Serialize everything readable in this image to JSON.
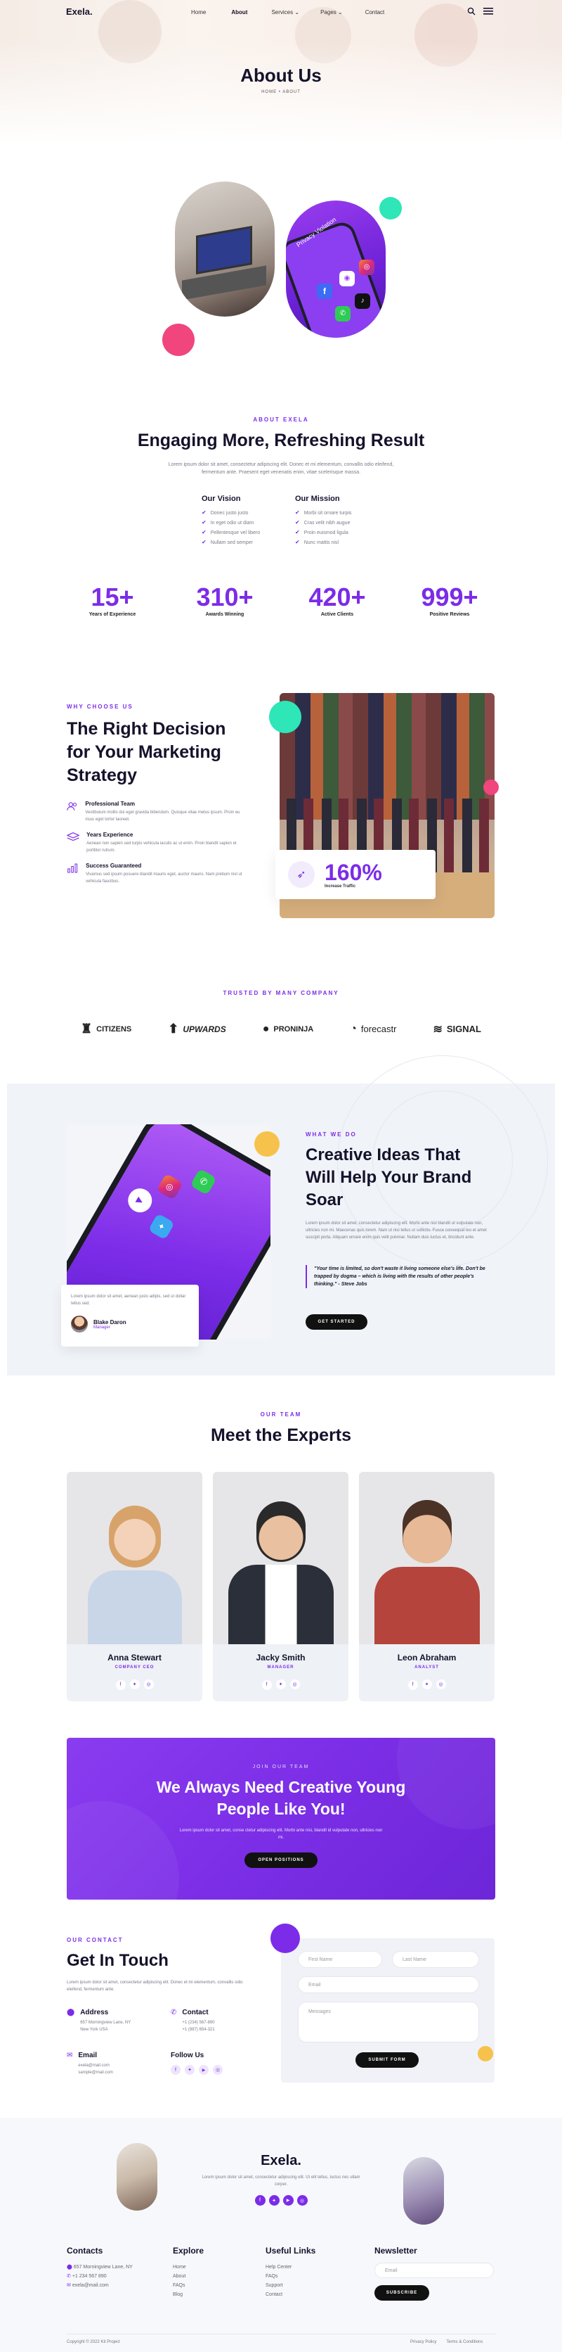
{
  "brand": {
    "logo": "Exela."
  },
  "nav": {
    "items": [
      {
        "label": "Home"
      },
      {
        "label": "About"
      },
      {
        "label": "Services",
        "caret": "⌄"
      },
      {
        "label": "Pages",
        "caret": "⌄"
      },
      {
        "label": "Contact"
      }
    ]
  },
  "hero": {
    "title": "About Us",
    "crumb_home": "HOME",
    "crumb_sep": "•",
    "crumb_current": "ABOUT"
  },
  "about": {
    "eyebrow": "ABOUT EXELA",
    "title": "Engaging More, Refreshing Result",
    "desc": "Lorem ipsum dolor sit amet, consectetur adipiscing elit. Donec et mi elementum, convallis odio eleifend, fermentum ante. Praesent eget venenatis enim, vitae scelerisque massa.",
    "phone_text": "Privacy Violation",
    "vision": {
      "title": "Our Vision",
      "items": [
        "Donec justo justo",
        "In eget odio ut diam",
        "Pellentesque vel libero",
        "Nullam sed semper"
      ]
    },
    "mission": {
      "title": "Our Mission",
      "items": [
        "Morbi sit ornare turpis",
        "Cras velit nibh augue",
        "Proin euismod ligula",
        "Nunc mattis nisl"
      ]
    }
  },
  "stats": [
    {
      "num": "15+",
      "label": "Years of Experience"
    },
    {
      "num": "310+",
      "label": "Awards Winning"
    },
    {
      "num": "420+",
      "label": "Active Clients"
    },
    {
      "num": "999+",
      "label": "Positive Reviews"
    }
  ],
  "why": {
    "eyebrow": "WHY CHOOSE US",
    "title_l1": "The Right Decision",
    "title_l2": "for Your Marketing",
    "title_l3": "Strategy",
    "features": [
      {
        "title": "Professional Team",
        "desc": "Vestibulum mollis dui eget gravida bibendum. Quisque vitae metus ipsum. Proin eu risus eget tortor laoreet."
      },
      {
        "title": "Years Experience",
        "desc": "Aenean non sapien sed turpis vehicula iaculis ac ut enim. Proin blandit sapien et porttitor rutrum."
      },
      {
        "title": "Success Guaranteed",
        "desc": "Vivamus sed ipsum posuere blandit mauris eget, auctor mauris. Nam pretium nisl ut vehicula faucibus."
      }
    ],
    "badge_num": "160%",
    "badge_label": "Increase Traffic"
  },
  "trusted": {
    "eyebrow": "TRUSTED BY MANY COMPANY",
    "logos": [
      "CITIZENS",
      "UPWARDS",
      "PRONINJA",
      "forecastr",
      "SIGNAL"
    ]
  },
  "creative": {
    "eyebrow": "WHAT WE DO",
    "title_l1": "Creative Ideas That",
    "title_l2": "Will Help Your Brand",
    "title_l3": "Soar",
    "desc": "Lorem ipsum dolor sit amet, consectetur adipiscing elit. Morbi ante nisl blandit ut vulputate non, ultricies non mi. Maecenas quis lorem. Nam ut nisi tellus ut sollicitu. Fusce consequat leo et amet suscipit porta. Aliquam ornare enim quis velit pulvinar. Nullam duis luctus et, tincidunt ante.",
    "quote": "\"Your time is limited, so don't waste it living someone else's life. Don't be trapped by dogma – which is living with the results of other people's thinking.\" - Steve Jobs",
    "button": "GET STARTED",
    "testimonial": "Lorem ipsum dolor sit amet, aenean justo adipis, sed ut dollar tellus sed.",
    "person_name": "Blake Daron",
    "person_role": "Manager"
  },
  "team": {
    "eyebrow": "OUR TEAM",
    "title": "Meet the Experts",
    "members": [
      {
        "name": "Anna Stewart",
        "role": "COMPANY CEO"
      },
      {
        "name": "Jacky Smith",
        "role": "MANAGER"
      },
      {
        "name": "Leon Abraham",
        "role": "ANALYST"
      }
    ]
  },
  "join": {
    "eyebrow": "JOIN OUR TEAM",
    "title_l1": "We Always Need Creative Young",
    "title_l2": "People Like You!",
    "desc": "Lorem ipsum dolor sit amet, conse ctetur adipiscing elit. Morbi ante nisi, blandit id vulputate non, ultricies non mi.",
    "button": "OPEN POSITIONS"
  },
  "contact": {
    "eyebrow": "OUR CONTACT",
    "title": "Get In Touch",
    "desc": "Lorem ipsum dolor sit amet, consectetur adipiscing elit. Donec et mi elementum, convallis odio eleifend, fermentum ante.",
    "address_title": "Address",
    "address_l1": "657 Morningview Lane, NY",
    "address_l2": "New York USA",
    "contact_title": "Contact",
    "phone1": "+1 (234) 567-890",
    "phone2": "+1 (987) 654-321",
    "email_title": "Email",
    "email1": "exela@mail.com",
    "email2": "sample@mail.com",
    "follow_title": "Follow Us",
    "form": {
      "first": "First Name",
      "last": "Last Name",
      "email": "Email",
      "message": "Messages",
      "submit": "SUBMIT FORM"
    }
  },
  "footer": {
    "logo": "Exela.",
    "desc": "Lorem ipsum dolor sit amet, consectetur adipiscing elit. Ut elit tellus, luctus nec ullam corper.",
    "contacts_title": "Contacts",
    "contacts": [
      "657 Morningview Lane, NY",
      "+1 234 567 890",
      "exela@mail.com"
    ],
    "explore_title": "Explore",
    "explore": [
      "Home",
      "About",
      "FAQs",
      "Blog"
    ],
    "useful_title": "Useful Links",
    "useful": [
      "Help Center",
      "FAQs",
      "Support",
      "Contact"
    ],
    "news_title": "Newsletter",
    "news_placeholder": "Email",
    "news_button": "SUBSCRIBE",
    "copyright": "Copyright © 2022 Kit Project",
    "legal1": "Privacy Policy",
    "legal2": "Terms & Conditions"
  },
  "colors": {
    "accent": "#7c2ce8",
    "mint": "#2ee6b7",
    "pink": "#f0457d",
    "yellow": "#f7c24c"
  }
}
